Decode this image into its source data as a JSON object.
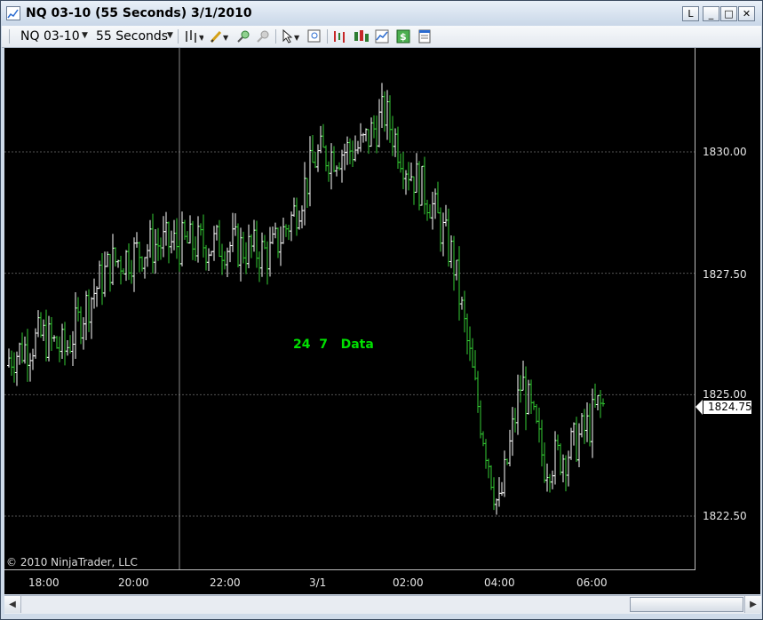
{
  "window": {
    "title": "NQ 03-10 (55 Seconds)  3/1/2010",
    "controls": {
      "link": "L",
      "minimize": "_",
      "maximize": "□",
      "close": "✕"
    }
  },
  "toolbar": {
    "instrument": "NQ 03-10",
    "interval": "55 Seconds",
    "icons": [
      "bar-type-icon",
      "drawing-pencil-icon",
      "zoom-in-icon",
      "zoom-out-icon",
      "pointer-icon",
      "data-box-icon",
      "indicators-icon",
      "strategies-icon",
      "chart-trader-icon",
      "money-icon",
      "properties-icon"
    ]
  },
  "chart": {
    "watermark": "24  7   Data",
    "copyright": "© 2010 NinjaTrader, LLC",
    "current_price": "1824.75",
    "colors": {
      "background": "#000000",
      "up_bar": "#ffffff",
      "down_bar": "#33cc33",
      "grid": "#555555"
    }
  },
  "chart_data": {
    "type": "ohlc",
    "y_ticks": [
      "1830.00",
      "1827.50",
      "1825.00",
      "1822.50"
    ],
    "x_ticks": [
      "18:00",
      "20:00",
      "22:00",
      "3/1",
      "02:00",
      "04:00",
      "06:00"
    ],
    "ylim": [
      1821.0,
      1832.5
    ],
    "series_price_path": [
      {
        "x": "17:00",
        "y": 1825.6
      },
      {
        "x": "17:30",
        "y": 1825.9
      },
      {
        "x": "18:00",
        "y": 1826.2
      },
      {
        "x": "18:30",
        "y": 1825.9
      },
      {
        "x": "19:00",
        "y": 1826.9
      },
      {
        "x": "19:30",
        "y": 1827.7
      },
      {
        "x": "20:00",
        "y": 1827.9
      },
      {
        "x": "20:30",
        "y": 1828.1
      },
      {
        "x": "21:00",
        "y": 1828.1
      },
      {
        "x": "22:00",
        "y": 1828.1
      },
      {
        "x": "23:00",
        "y": 1827.9
      },
      {
        "x": "23:30",
        "y": 1828.7
      },
      {
        "x": "0:00",
        "y": 1829.9
      },
      {
        "x": "1:00",
        "y": 1830.1
      },
      {
        "x": "1:30",
        "y": 1830.8
      },
      {
        "x": "2:00",
        "y": 1829.7
      },
      {
        "x": "2:30",
        "y": 1829.0
      },
      {
        "x": "3:00",
        "y": 1827.8
      },
      {
        "x": "3:30",
        "y": 1825.0
      },
      {
        "x": "4:00",
        "y": 1822.6
      },
      {
        "x": "4:30",
        "y": 1825.3
      },
      {
        "x": "5:00",
        "y": 1823.6
      },
      {
        "x": "5:30",
        "y": 1823.8
      },
      {
        "x": "6:00",
        "y": 1824.4
      },
      {
        "x": "6:10",
        "y": 1824.75
      }
    ]
  }
}
